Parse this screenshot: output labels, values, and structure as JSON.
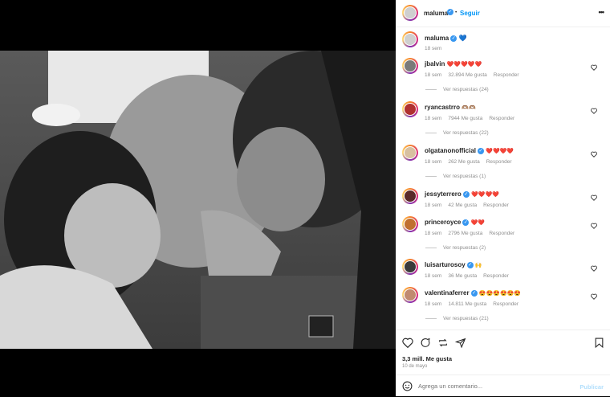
{
  "post": {
    "author": "maluma",
    "follow_label": "Seguir",
    "caption_author": "maluma",
    "caption_emoji": "💙",
    "caption_time": "18 sem",
    "likes": "3,3 mill. Me gusta",
    "date": "10 de mayo",
    "comment_placeholder": "Agrega un comentario...",
    "publish_label": "Publicar",
    "more_label": "•••"
  },
  "comments": [
    {
      "user": "jbalvin",
      "verified": false,
      "text": "❤️❤️❤️❤️❤️",
      "time": "18 sem",
      "likes": "32.894 Me gusta",
      "reply": "Responder",
      "replies": "Ver respuestas (24)"
    },
    {
      "user": "ryancastrro",
      "verified": false,
      "text": "🫶🏽🫶🏽",
      "time": "18 sem",
      "likes": "7944 Me gusta",
      "reply": "Responder",
      "replies": "Ver respuestas (22)"
    },
    {
      "user": "olgatanonofficial",
      "verified": true,
      "text": "❤️❤️❤️❤️",
      "time": "18 sem",
      "likes": "262 Me gusta",
      "reply": "Responder",
      "replies": "Ver respuestas (1)"
    },
    {
      "user": "jessyterrero",
      "verified": true,
      "text": "❤️❤️❤️❤️",
      "time": "18 sem",
      "likes": "42 Me gusta",
      "reply": "Responder",
      "replies": ""
    },
    {
      "user": "princeroyce",
      "verified": true,
      "text": "❤️❤️",
      "time": "18 sem",
      "likes": "2796 Me gusta",
      "reply": "Responder",
      "replies": "Ver respuestas (2)"
    },
    {
      "user": "luisarturosoy",
      "verified": true,
      "text": "🙌",
      "time": "18 sem",
      "likes": "36 Me gusta",
      "reply": "Responder",
      "replies": ""
    },
    {
      "user": "valentinaferrer",
      "verified": true,
      "text": "😍😍😍😍😍😍",
      "time": "18 sem",
      "likes": "14.811 Me gusta",
      "reply": "Responder",
      "replies": "Ver respuestas (21)"
    }
  ],
  "colors": {
    "accent": "#0095f6",
    "verified": "#3897f0",
    "like": "#ed4956"
  }
}
